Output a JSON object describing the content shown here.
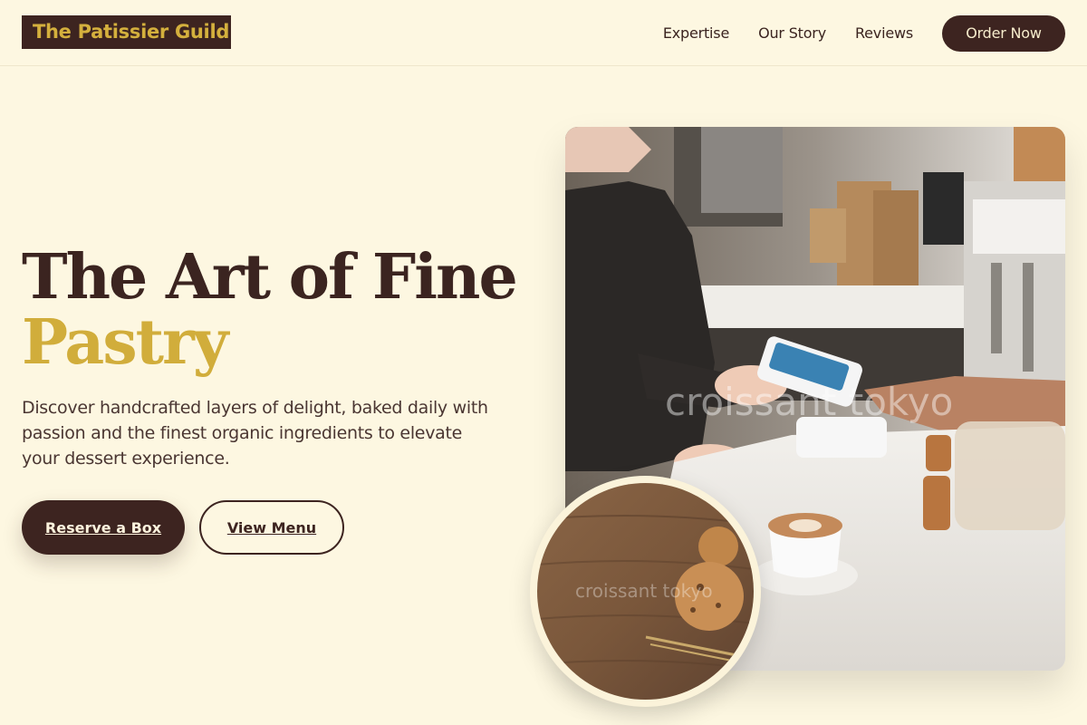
{
  "brand": {
    "name": "The Patissier Guild"
  },
  "nav": {
    "links": [
      "Expertise",
      "Our Story",
      "Reviews"
    ],
    "cta": "Order Now"
  },
  "hero": {
    "title_line1": "The Art of Fine",
    "title_line2": "Pastry",
    "subtitle": "Discover handcrafted layers of delight, baked daily with passion and the finest organic ingredients to elevate your dessert experience.",
    "primary_cta": "Reserve a Box",
    "secondary_cta": "View Menu"
  },
  "images": {
    "main_photo_watermark": "croissant tokyo",
    "inset_photo_watermark": "croissant tokyo"
  },
  "colors": {
    "background": "#fdf7e1",
    "brand_dark": "#3d2420",
    "accent_gold": "#d1ad3b"
  }
}
